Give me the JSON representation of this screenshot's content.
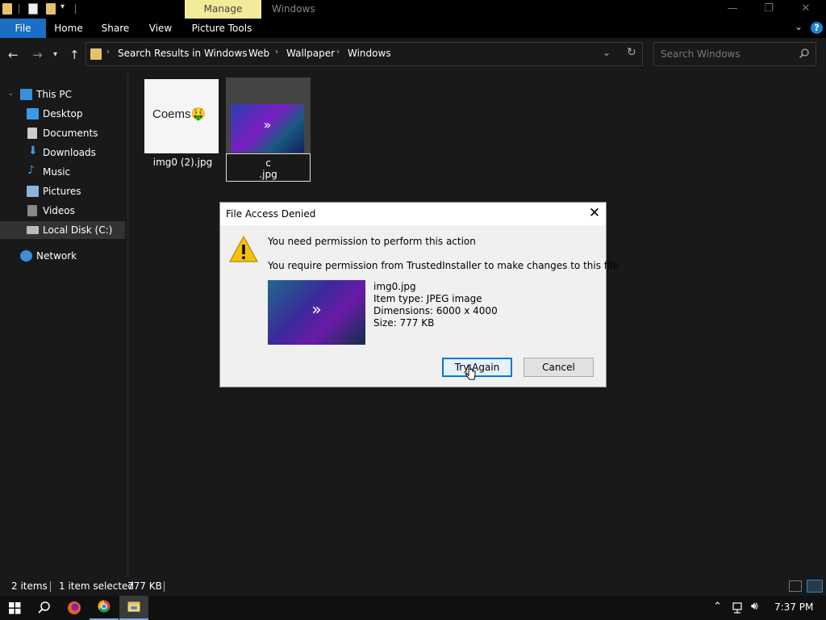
{
  "titlebar": {
    "context_tab": "Manage",
    "title": "Windows",
    "controls": {
      "minimize": "—",
      "maximize": "❐",
      "close": "✕"
    }
  },
  "ribbon": {
    "tabs": [
      "File",
      "Home",
      "Share",
      "View",
      "Picture Tools"
    ],
    "help": "?"
  },
  "address": {
    "breadcrumbs": [
      "Search Results in Windows",
      "Web",
      "Wallpaper",
      "Windows"
    ],
    "search_placeholder": "Search Windows"
  },
  "nav": {
    "items": [
      {
        "label": "This PC",
        "icon": "computer-icon"
      },
      {
        "label": "Desktop",
        "icon": "desktop-icon"
      },
      {
        "label": "Documents",
        "icon": "documents-icon"
      },
      {
        "label": "Downloads",
        "icon": "downloads-icon"
      },
      {
        "label": "Music",
        "icon": "music-icon"
      },
      {
        "label": "Pictures",
        "icon": "pictures-icon"
      },
      {
        "label": "Videos",
        "icon": "videos-icon"
      },
      {
        "label": "Local Disk (C:)",
        "icon": "disk-icon"
      },
      {
        "label": "Network",
        "icon": "network-icon"
      }
    ]
  },
  "files": {
    "item1": {
      "thumb_text": "Coems🤑",
      "label": "img0 (2).jpg"
    },
    "item2": {
      "rename_line1": "c",
      "rename_line2": ".jpg",
      "thumb_glyph": "»"
    }
  },
  "status": {
    "items": "2 items",
    "selected": "1 item selected",
    "size": "777 KB"
  },
  "taskbar": {
    "clock": "7:37 PM"
  },
  "dialog": {
    "title": "File Access Denied",
    "close": "✕",
    "heading": "You need permission to perform this action",
    "message": "You require permission from TrustedInstaller to make changes to this file",
    "thumb_glyph": "»",
    "file_name": "img0.jpg",
    "item_type": "Item type: JPEG image",
    "dimensions": "Dimensions: 6000 x 4000",
    "size": "Size: 777 KB",
    "try_again": "Try Again",
    "cancel": "Cancel"
  },
  "colors": {
    "accent": "#1a6fc4",
    "manage_tab": "#f2eb9a",
    "background": "#191919"
  }
}
